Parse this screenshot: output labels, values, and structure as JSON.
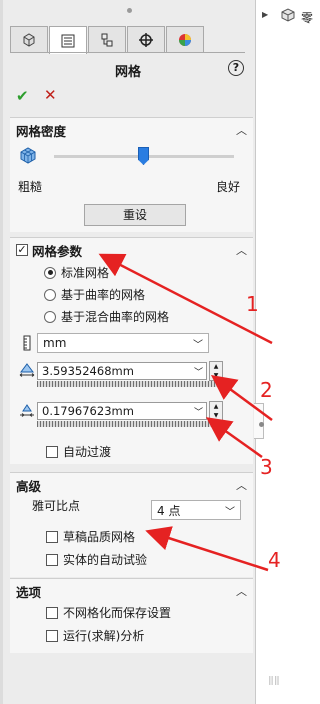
{
  "panel": {
    "title": "网格",
    "help_label": "?",
    "ok_label": "✔",
    "cancel_label": "✕",
    "tabs": [
      "feature-manager-icon",
      "property-manager-icon",
      "configuration-manager-icon",
      "dimxpert-icon",
      "display-manager-icon"
    ]
  },
  "mesh_density": {
    "title": "网格密度",
    "coarse_label": "粗糙",
    "fine_label": "良好",
    "reset_label": "重设",
    "slider_level": 0.5
  },
  "mesh_params": {
    "title": "网格参数",
    "checked": true,
    "options": [
      "标准网格",
      "基于曲率的网格",
      "基于混合曲率的网格"
    ],
    "selected_index": 0,
    "unit": "mm",
    "global_size": "3.59352468mm",
    "tolerance": "0.17967623mm",
    "auto_transition_label": "自动过渡"
  },
  "advanced": {
    "title": "高级",
    "jacobian_label": "雅可比点",
    "jacobian_value": "4 点",
    "draft_quality_label": "草稿品质网格",
    "auto_trials_label": "实体的自动试验"
  },
  "options": {
    "title": "选项",
    "no_mesh_save_label": "不网格化而保存设置",
    "run_analysis_label": "运行(求解)分析"
  },
  "tree": {
    "label": "零"
  },
  "annotations": [
    "1",
    "2",
    "3",
    "4"
  ],
  "accent_color": "#e52222"
}
